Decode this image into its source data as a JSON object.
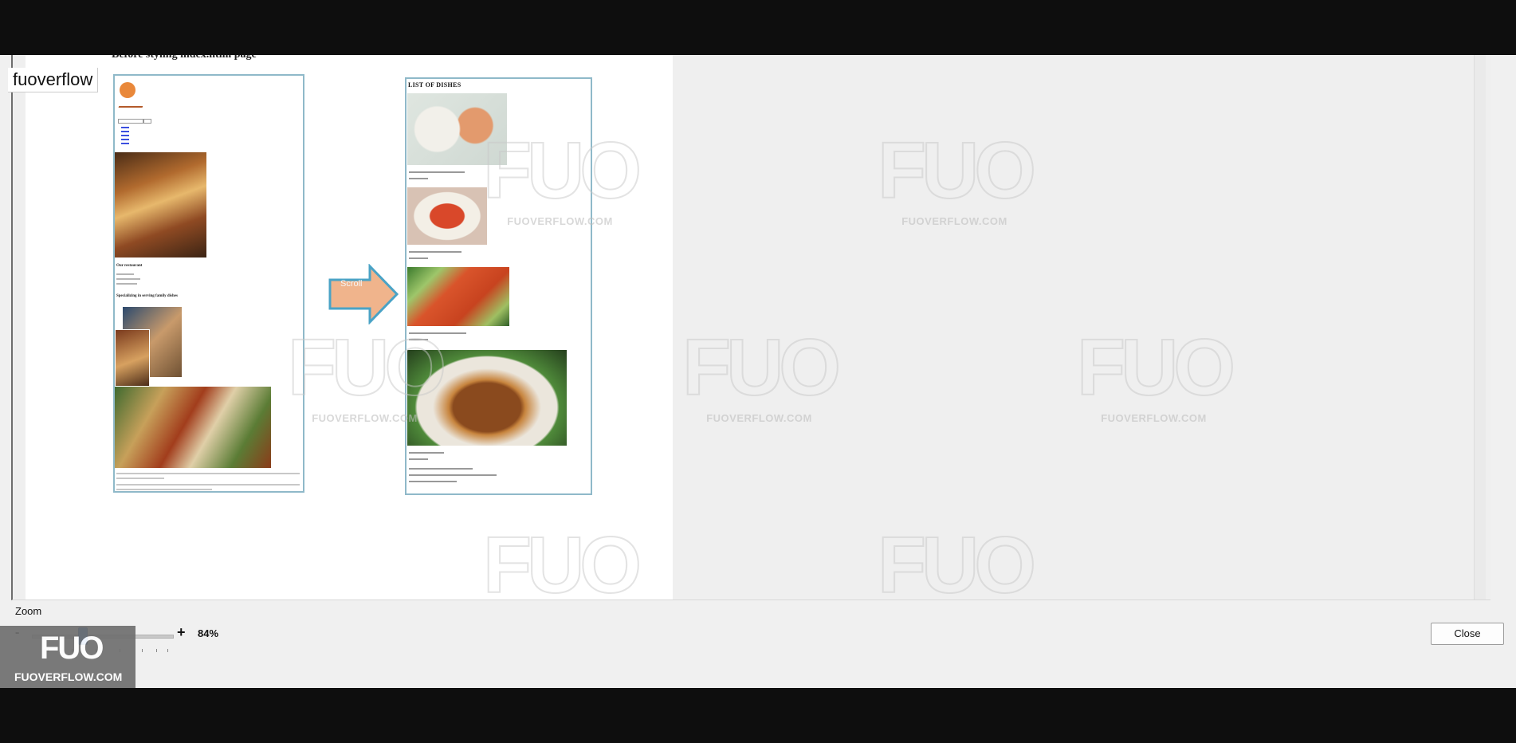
{
  "overlay_label": "fuoverflow",
  "slide": {
    "title": "Before styling index.html page",
    "arrow_label": "Scroll",
    "before_mock": {
      "heading1": "Our restaurant",
      "heading2": "Specializing in serving family dishes"
    },
    "after_mock": {
      "title": "LIST OF DISHES"
    }
  },
  "controls": {
    "zoom_label": "Zoom",
    "minus": "-",
    "plus": "+",
    "zoom_value": "84%",
    "zoom_fraction": 0.84,
    "close_label": "Close"
  },
  "watermark": {
    "logo": "FUO",
    "url": "FUOVERFLOW.COM"
  },
  "colors": {
    "arrow_fill": "#f0b48c",
    "arrow_stroke": "#4aa3c6",
    "slider_thumb": "#1e6fd9"
  }
}
